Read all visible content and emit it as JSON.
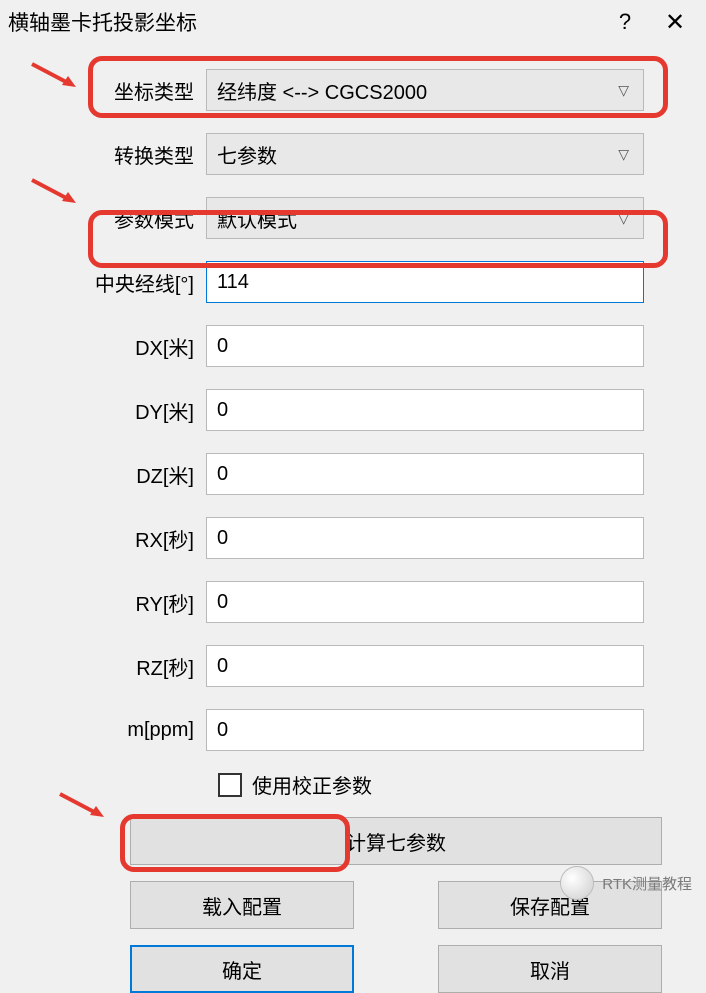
{
  "titlebar": {
    "title": "横轴墨卡托投影坐标",
    "help": "?",
    "close": "✕"
  },
  "form": {
    "coord_type": {
      "label": "坐标类型",
      "value": "经纬度 <--> CGCS2000"
    },
    "convert_type": {
      "label": "转换类型",
      "value": "七参数"
    },
    "param_mode": {
      "label": "参数模式",
      "value": "默认模式"
    },
    "central_meridian": {
      "label": "中央经线[°]",
      "value": "114"
    },
    "dx": {
      "label": "DX[米]",
      "value": "0"
    },
    "dy": {
      "label": "DY[米]",
      "value": "0"
    },
    "dz": {
      "label": "DZ[米]",
      "value": "0"
    },
    "rx": {
      "label": "RX[秒]",
      "value": "0"
    },
    "ry": {
      "label": "RY[秒]",
      "value": "0"
    },
    "rz": {
      "label": "RZ[秒]",
      "value": "0"
    },
    "m": {
      "label": "m[ppm]",
      "value": "0"
    },
    "use_correction": "使用校正参数"
  },
  "buttons": {
    "calc": "计算七参数",
    "load": "载入配置",
    "save": "保存配置",
    "ok": "确定",
    "cancel": "取消"
  },
  "watermark": "RTK测量教程"
}
